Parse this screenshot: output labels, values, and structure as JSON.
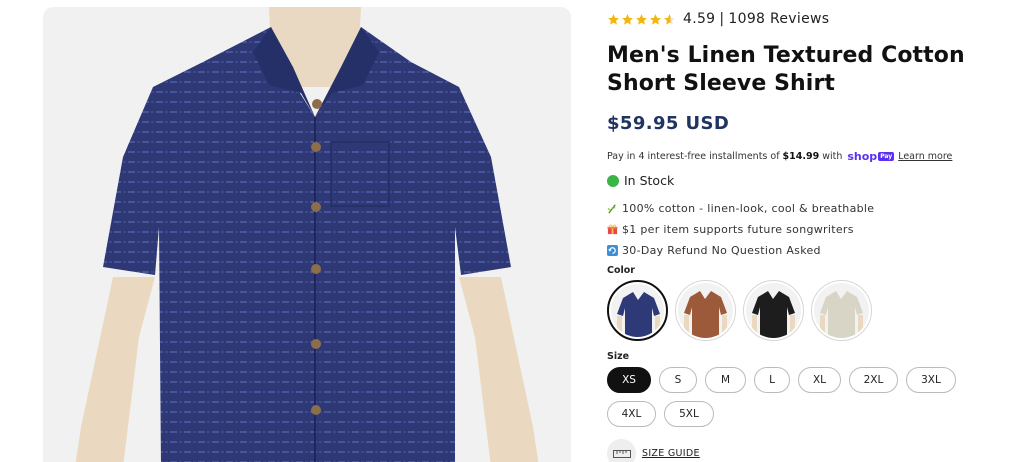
{
  "product": {
    "rating": "4.59",
    "rating_separator": "|",
    "reviews": "1098 Reviews",
    "stars_filled": 4.59,
    "title": "Men's Linen Textured Cotton Short Sleeve Shirt",
    "price": "$59.95 USD",
    "installments": {
      "prefix": "Pay in 4 interest-free installments of",
      "amount": "$14.99",
      "with": "with",
      "brand": "shop",
      "brand_badge": "Pay",
      "learn_more": "Learn more"
    },
    "stock": "In Stock",
    "features": [
      {
        "icon": "bamboo-icon",
        "text": "100% cotton - linen-look, cool & breathable"
      },
      {
        "icon": "gift-icon",
        "text": "$1 per item supports future songwriters"
      },
      {
        "icon": "refresh-icon",
        "text": "30-Day Refund No Question Asked"
      }
    ],
    "color_label": "Color",
    "colors": [
      {
        "name": "navy",
        "hex": "#2e3a78",
        "selected": true
      },
      {
        "name": "rust",
        "hex": "#9c5a3a",
        "selected": false
      },
      {
        "name": "black",
        "hex": "#1d1d1d",
        "selected": false
      },
      {
        "name": "cream",
        "hex": "#d8d4c6",
        "selected": false
      }
    ],
    "size_label": "Size",
    "sizes": [
      "XS",
      "S",
      "M",
      "L",
      "XL",
      "2XL",
      "3XL",
      "4XL",
      "5XL"
    ],
    "selected_size": "XS",
    "size_guide": "SIZE GUIDE"
  },
  "colors": {
    "price": "#1f3461",
    "star": "#f5b50a",
    "stock_dot": "#3bb54a",
    "shop_pay": "#5a31f4"
  }
}
